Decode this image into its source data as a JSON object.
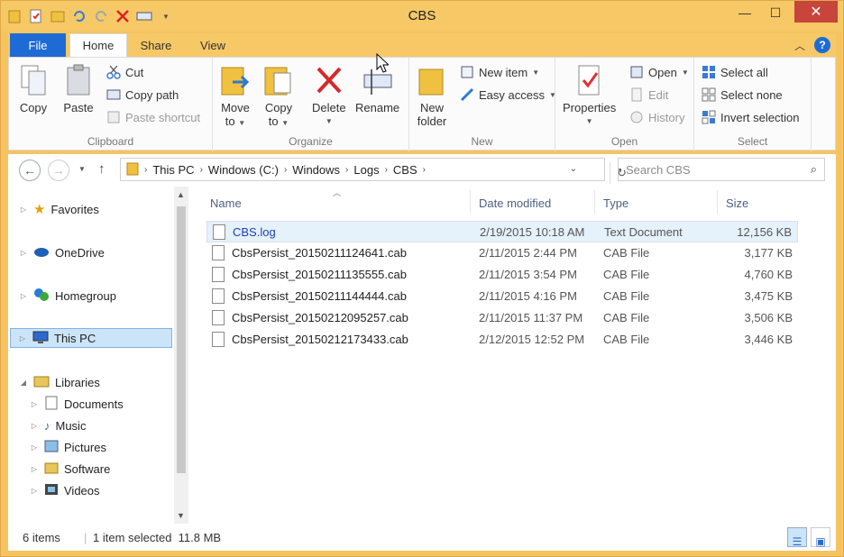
{
  "window": {
    "title": "CBS"
  },
  "ribbon_tabs": [
    "File",
    "Home",
    "Share",
    "View"
  ],
  "clipboard": {
    "copy": "Copy",
    "paste": "Paste",
    "cut": "Cut",
    "copy_path": "Copy path",
    "paste_shortcut": "Paste shortcut",
    "label": "Clipboard"
  },
  "organize": {
    "move_to": [
      "Move",
      "to"
    ],
    "copy_to": [
      "Copy",
      "to"
    ],
    "delete": "Delete",
    "rename": "Rename",
    "label": "Organize"
  },
  "new": {
    "new_folder": [
      "New",
      "folder"
    ],
    "new_item": "New item",
    "easy_access": "Easy access",
    "label": "New"
  },
  "open": {
    "properties": "Properties",
    "open": "Open",
    "edit": "Edit",
    "history": "History",
    "label": "Open"
  },
  "select": {
    "select_all": "Select all",
    "select_none": "Select none",
    "invert": "Invert selection",
    "label": "Select"
  },
  "address": {
    "path": [
      "This PC",
      "Windows (C:)",
      "Windows",
      "Logs",
      "CBS"
    ],
    "search_placeholder": "Search CBS"
  },
  "nav": {
    "favorites": "Favorites",
    "onedrive": "OneDrive",
    "homegroup": "Homegroup",
    "this_pc": "This PC",
    "libraries": "Libraries",
    "library_items": [
      "Documents",
      "Music",
      "Pictures",
      "Software",
      "Videos"
    ]
  },
  "columns": {
    "name": "Name",
    "date": "Date modified",
    "type": "Type",
    "size": "Size"
  },
  "files": [
    {
      "name": "CBS.log",
      "date": "2/19/2015 10:18 AM",
      "type": "Text Document",
      "size": "12,156 KB"
    },
    {
      "name": "CbsPersist_20150211124641.cab",
      "date": "2/11/2015 2:44 PM",
      "type": "CAB File",
      "size": "3,177 KB"
    },
    {
      "name": "CbsPersist_20150211135555.cab",
      "date": "2/11/2015 3:54 PM",
      "type": "CAB File",
      "size": "4,760 KB"
    },
    {
      "name": "CbsPersist_20150211144444.cab",
      "date": "2/11/2015 4:16 PM",
      "type": "CAB File",
      "size": "3,475 KB"
    },
    {
      "name": "CbsPersist_20150212095257.cab",
      "date": "2/11/2015 11:37 PM",
      "type": "CAB File",
      "size": "3,506 KB"
    },
    {
      "name": "CbsPersist_20150212173433.cab",
      "date": "2/12/2015 12:52 PM",
      "type": "CAB File",
      "size": "3,446 KB"
    }
  ],
  "status": {
    "count": "6 items",
    "selection": "1 item selected  11.8 MB"
  },
  "colors": {
    "accent": "#1e6bd6",
    "frame": "#f5c460",
    "selection": "#e5f1fb"
  }
}
